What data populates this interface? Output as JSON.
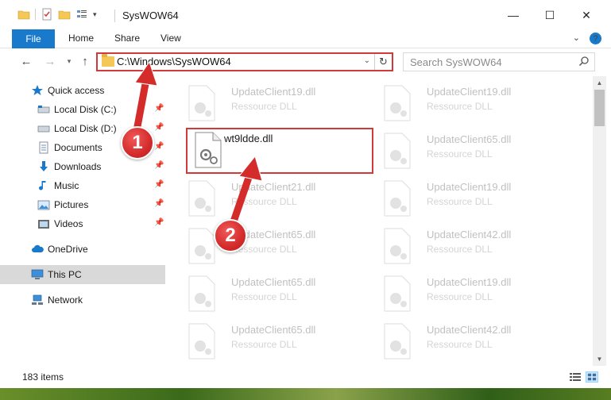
{
  "window": {
    "title": "SysWOW64",
    "controls": {
      "minimize": "—",
      "maximize": "☐",
      "close": "✕"
    }
  },
  "ribbon": {
    "tabs": [
      "File",
      "Home",
      "Share",
      "View"
    ],
    "expand_glyph": "⌄",
    "help_glyph": "?"
  },
  "address": {
    "path": "C:\\Windows\\SysWOW64",
    "search_placeholder": "Search SysWOW64"
  },
  "sidebar": {
    "items": [
      {
        "label": "Quick access",
        "icon": "star-icon",
        "pinned": false
      },
      {
        "label": "Local Disk (C:)",
        "icon": "disk-icon",
        "pinned": true
      },
      {
        "label": "Local Disk (D:)",
        "icon": "disk-icon",
        "pinned": true
      },
      {
        "label": "Documents",
        "icon": "documents-icon",
        "pinned": true
      },
      {
        "label": "Downloads",
        "icon": "download-icon",
        "pinned": true
      },
      {
        "label": "Music",
        "icon": "music-icon",
        "pinned": true
      },
      {
        "label": "Pictures",
        "icon": "pictures-icon",
        "pinned": true
      },
      {
        "label": "Videos",
        "icon": "videos-icon",
        "pinned": true
      },
      {
        "label": "OneDrive",
        "icon": "cloud-icon",
        "pinned": false
      },
      {
        "label": "This PC",
        "icon": "computer-icon",
        "pinned": false,
        "selected": true
      },
      {
        "label": "Network",
        "icon": "network-icon",
        "pinned": false
      }
    ]
  },
  "files": {
    "left_column": [
      {
        "name": "UpdateClient19.dll",
        "type": "Ressource DLL"
      },
      {
        "name": "wt9ldde.dll",
        "type": ""
      },
      {
        "name": "UpdateClient21.dll",
        "type": "Ressource DLL"
      },
      {
        "name": "UpdateClient65.dll",
        "type": "Ressource DLL"
      },
      {
        "name": "UpdateClient65.dll",
        "type": "Ressource DLL"
      },
      {
        "name": "UpdateClient65.dll",
        "type": "Ressource DLL"
      }
    ],
    "right_column": [
      {
        "name": "UpdateClient19.dll",
        "type": "Ressource DLL"
      },
      {
        "name": "UpdateClient65.dll",
        "type": "Ressource DLL"
      },
      {
        "name": "UpdateClient19.dll",
        "type": "Ressource DLL"
      },
      {
        "name": "UpdateClient42.dll",
        "type": "Ressource DLL"
      },
      {
        "name": "UpdateClient19.dll",
        "type": "Ressource DLL"
      },
      {
        "name": "UpdateClient42.dll",
        "type": "Ressource DLL"
      }
    ]
  },
  "status": {
    "item_count": "183 items"
  },
  "annotations": {
    "step1": "1",
    "step2": "2"
  },
  "colors": {
    "accent": "#1979ca",
    "highlight": "#d23a3a",
    "selection": "#cce8ff"
  }
}
